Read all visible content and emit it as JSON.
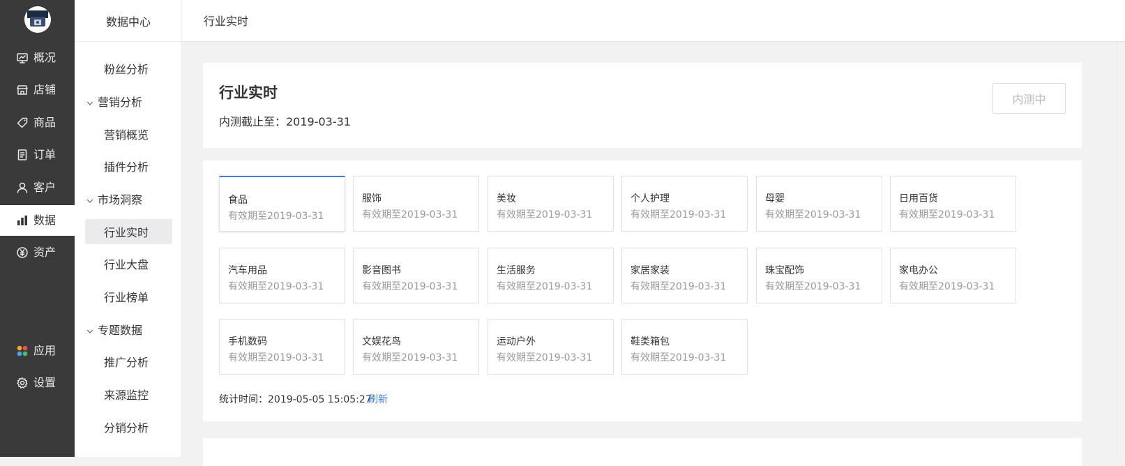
{
  "nav": {
    "items": [
      {
        "label": "概况",
        "icon": "monitor-icon"
      },
      {
        "label": "店铺",
        "icon": "store-icon"
      },
      {
        "label": "商品",
        "icon": "tag-icon"
      },
      {
        "label": "订单",
        "icon": "order-icon"
      },
      {
        "label": "客户",
        "icon": "user-icon"
      },
      {
        "label": "数据",
        "icon": "bar-chart-icon"
      },
      {
        "label": "资产",
        "icon": "yen-icon"
      },
      {
        "label": "应用",
        "icon": "apps-icon"
      },
      {
        "label": "设置",
        "icon": "gear-icon"
      }
    ],
    "active_label": "数据"
  },
  "subnav": {
    "title": "数据中心",
    "items": [
      {
        "label": "粉丝分析",
        "type": "child"
      },
      {
        "label": "营销分析",
        "type": "group"
      },
      {
        "label": "营销概览",
        "type": "child"
      },
      {
        "label": "插件分析",
        "type": "child"
      },
      {
        "label": "市场洞察",
        "type": "group"
      },
      {
        "label": "行业实时",
        "type": "child"
      },
      {
        "label": "行业大盘",
        "type": "child"
      },
      {
        "label": "行业榜单",
        "type": "child"
      },
      {
        "label": "专题数据",
        "type": "group"
      },
      {
        "label": "推广分析",
        "type": "child"
      },
      {
        "label": "来源监控",
        "type": "child"
      },
      {
        "label": "分销分析",
        "type": "child"
      }
    ],
    "active_label": "行业实时"
  },
  "header": {
    "breadcrumb": "行业实时"
  },
  "page": {
    "title": "行业实时",
    "beta_deadline": "内测截止至：2019-03-31",
    "beta_button": "内测中"
  },
  "industries": [
    {
      "name": "食品",
      "valid": "有效期至2019-03-31"
    },
    {
      "name": "服饰",
      "valid": "有效期至2019-03-31"
    },
    {
      "name": "美妆",
      "valid": "有效期至2019-03-31"
    },
    {
      "name": "个人护理",
      "valid": "有效期至2019-03-31"
    },
    {
      "name": "母婴",
      "valid": "有效期至2019-03-31"
    },
    {
      "name": "日用百货",
      "valid": "有效期至2019-03-31"
    },
    {
      "name": "汽车用品",
      "valid": "有效期至2019-03-31"
    },
    {
      "name": "影音图书",
      "valid": "有效期至2019-03-31"
    },
    {
      "name": "生活服务",
      "valid": "有效期至2019-03-31"
    },
    {
      "name": "家居家装",
      "valid": "有效期至2019-03-31"
    },
    {
      "name": "珠宝配饰",
      "valid": "有效期至2019-03-31"
    },
    {
      "name": "家电办公",
      "valid": "有效期至2019-03-31"
    },
    {
      "name": "手机数码",
      "valid": "有效期至2019-03-31"
    },
    {
      "name": "文娱花鸟",
      "valid": "有效期至2019-03-31"
    },
    {
      "name": "运动户外",
      "valid": "有效期至2019-03-31"
    },
    {
      "name": "鞋类箱包",
      "valid": "有效期至2019-03-31"
    }
  ],
  "active_industry": "食品",
  "stats": {
    "time_text": "统计时间：2019-05-05 15:05:27",
    "refresh_label": "刷新"
  },
  "colors": {
    "nav_bg": "#3a3a3a",
    "accent": "#3a7bf0"
  }
}
